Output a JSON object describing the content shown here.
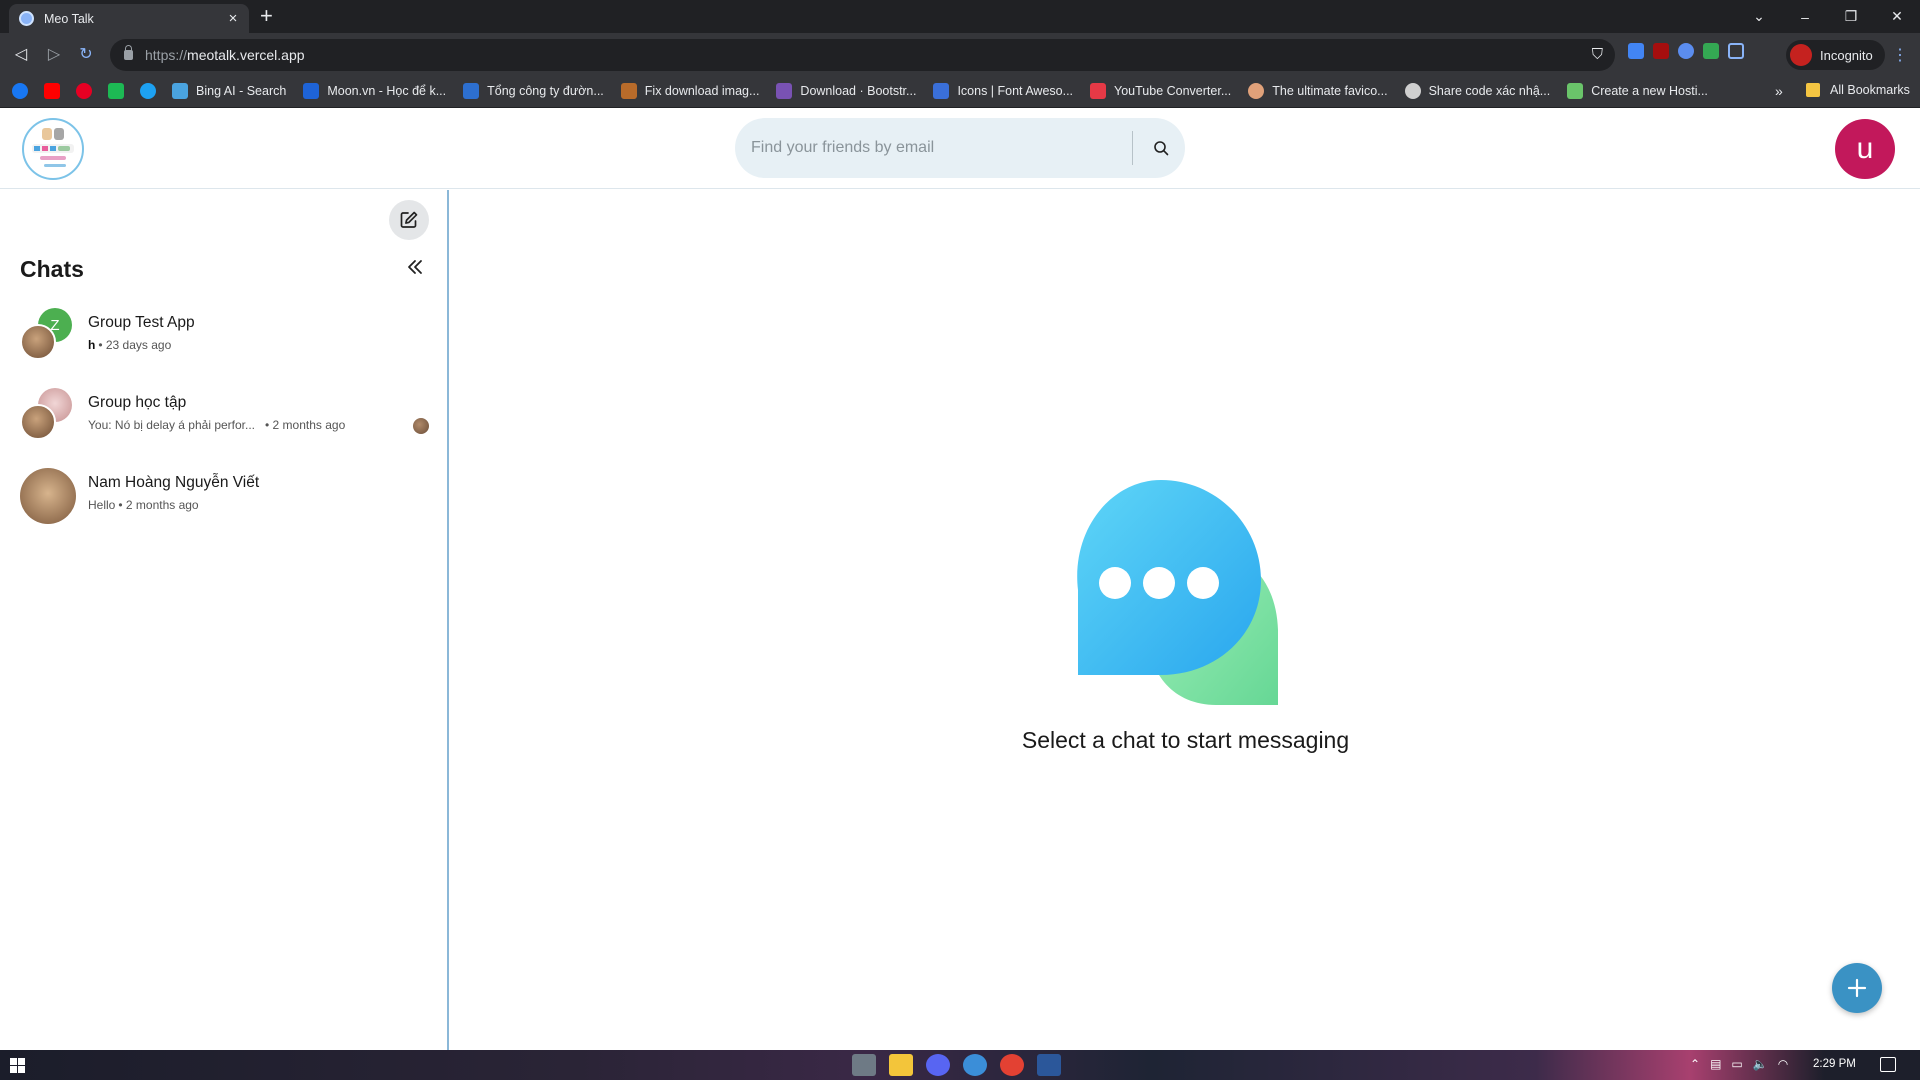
{
  "browser": {
    "tab_title": "Meo Talk",
    "tab_close": "×",
    "new_tab": "+",
    "url_scheme": "https://",
    "url_host": "meotalk.vercel.app",
    "incognito_label": "Incognito",
    "bookmarks": [
      {
        "label": "Bing AI - Search",
        "color": "#4aa3df"
      },
      {
        "label": "Moon.vn - Học để k...",
        "color": "#1e63d6"
      },
      {
        "label": "Tổng công ty đườn...",
        "color": "#2d6fcf"
      },
      {
        "label": "Fix download imag...",
        "color": "#b86b2a"
      },
      {
        "label": "Download · Bootstr...",
        "color": "#7952b3"
      },
      {
        "label": "Icons | Font Aweso...",
        "color": "#3a6fd8"
      },
      {
        "label": "YouTube Converter...",
        "color": "#e63946"
      },
      {
        "label": "The ultimate favico...",
        "color": "#e0a17a"
      },
      {
        "label": "Share code xác nhậ...",
        "color": "#cfcfcf"
      },
      {
        "label": "Create a new Hosti...",
        "color": "#6ac46a"
      }
    ],
    "bookmarks_overflow": "»",
    "all_bookmarks": "All Bookmarks"
  },
  "header": {
    "search_placeholder": "Find your friends by email",
    "user_initial": "u"
  },
  "sidebar": {
    "title": "Chats",
    "chats": [
      {
        "name": "Group Test App",
        "sender": "h",
        "message": "",
        "time": "• 23 days ago"
      },
      {
        "name": "Group học tập",
        "sender": "",
        "message": "You: Nó bị delay á phải perfor...",
        "time": "• 2 months ago"
      },
      {
        "name": "Nam Hoàng Nguyễn Viết",
        "sender": "",
        "message": "Hello",
        "time": "• 2 months ago"
      }
    ],
    "group_test_letter": "Z"
  },
  "main": {
    "empty_message": "Select a chat to start messaging"
  },
  "taskbar": {
    "time": "2:29 PM"
  },
  "colors": {
    "accent": "#3a92c4",
    "user_avatar": "#c2185b",
    "search_bg": "#e7f0f5"
  }
}
